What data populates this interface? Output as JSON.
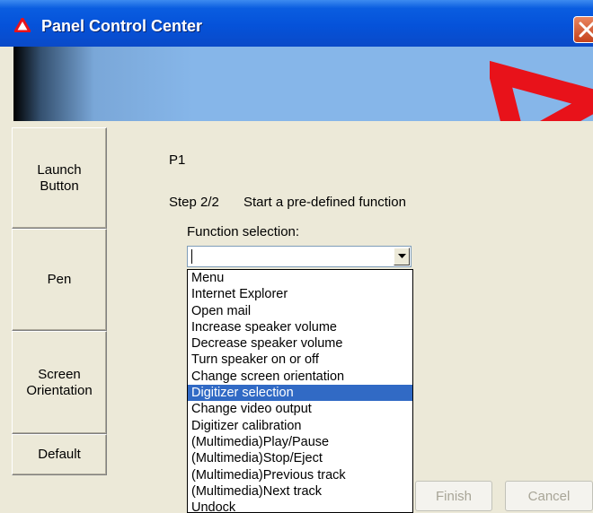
{
  "window": {
    "title": "Panel Control Center"
  },
  "nav": {
    "items": [
      {
        "label": "Launch\nButton"
      },
      {
        "label": "Pen"
      },
      {
        "label": "Screen\nOrientation"
      },
      {
        "label": "Default"
      }
    ]
  },
  "content": {
    "button_name": "P1",
    "step": "Step 2/2",
    "step_description": "Start a pre-defined function",
    "function_label": "Function selection:",
    "function_value": ""
  },
  "dropdown": {
    "selected_index": 7,
    "items": [
      "Menu",
      "Internet Explorer",
      "Open mail",
      "Increase speaker volume",
      "Decrease speaker volume",
      "Turn speaker on or off",
      "Change screen orientation",
      "Digitizer selection",
      "Change video output",
      "Digitizer calibration",
      "(Multimedia)Play/Pause",
      "(Multimedia)Stop/Eject",
      "(Multimedia)Previous track",
      "(Multimedia)Next track",
      "Undock"
    ]
  },
  "buttons": {
    "finish": "Finish",
    "cancel": "Cancel"
  },
  "colors": {
    "titlebar": "#0552d9",
    "selection": "#316ac5",
    "logo": "#e8121a"
  }
}
